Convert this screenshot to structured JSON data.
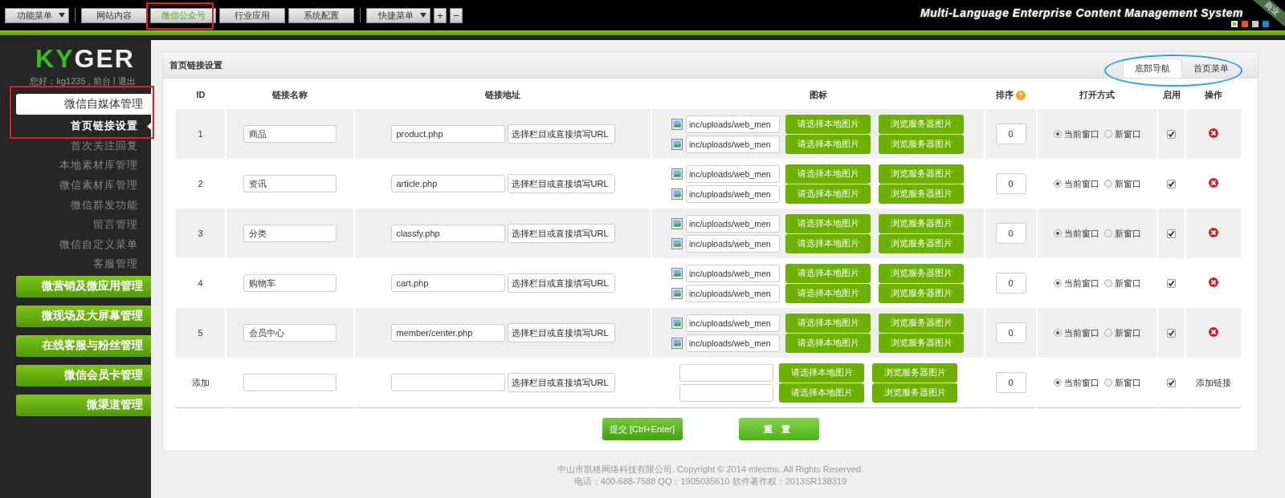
{
  "top_menu": {
    "items": [
      {
        "label": "功能菜单",
        "kind": "dropdown",
        "selected": false
      },
      {
        "label": "网站内容",
        "kind": "tab",
        "selected": false
      },
      {
        "label": "微信公众号",
        "kind": "tab",
        "selected": true
      },
      {
        "label": "行业应用",
        "kind": "tab",
        "selected": false
      },
      {
        "label": "系统配置",
        "kind": "tab",
        "selected": false
      },
      {
        "label": "快捷菜单",
        "kind": "dropdown",
        "selected": false
      },
      {
        "label": "+",
        "kind": "square",
        "selected": false
      },
      {
        "label": "−",
        "kind": "square",
        "selected": false
      }
    ]
  },
  "header": {
    "tagline": "Multi-Language Enterprise Content Management System",
    "ribbon": "商业",
    "theme_swatches": [
      {
        "color": "#8dc21f",
        "selected": true
      },
      {
        "color": "#e8531c",
        "selected": false
      },
      {
        "color": "#c8ccd0",
        "selected": false
      },
      {
        "color": "#1e88c8",
        "selected": false
      }
    ]
  },
  "sidebar": {
    "logo": "KYGER",
    "greeting": "您好：kg1235 ,",
    "links": [
      "前台",
      "退出"
    ],
    "separator": "|",
    "groups": [
      {
        "label": "微信自媒体管理",
        "expanded": true,
        "children": [
          {
            "label": "首页链接设置",
            "selected": true
          },
          {
            "label": "首次关注回复",
            "selected": false
          },
          {
            "label": "本地素材库管理",
            "selected": false
          },
          {
            "label": "微信素材库管理",
            "selected": false
          },
          {
            "label": "微信群发功能",
            "selected": false
          },
          {
            "label": "留言管理",
            "selected": false
          },
          {
            "label": "微信自定义菜单",
            "selected": false
          },
          {
            "label": "客服管理",
            "selected": false
          }
        ]
      },
      {
        "label": "微营销及微应用管理",
        "expanded": false
      },
      {
        "label": "微现场及大屏幕管理",
        "expanded": false
      },
      {
        "label": "在线客服与粉丝管理",
        "expanded": false
      },
      {
        "label": "微信会员卡管理",
        "expanded": false
      },
      {
        "label": "微渠道管理",
        "expanded": false
      }
    ]
  },
  "panel": {
    "title": "首页链接设置",
    "tabs": [
      {
        "label": "底部导航",
        "selected": true
      },
      {
        "label": "首页菜单",
        "selected": false
      }
    ],
    "table": {
      "columns": [
        "ID",
        "链接名称",
        "链接地址",
        "图标",
        "排序",
        "打开方式",
        "启用",
        "操作"
      ],
      "rows": [
        {
          "kind": "link",
          "id": "1",
          "name": "商品",
          "url": "product.php",
          "url_select": "选择栏目或直接填写URL",
          "icons": [
            {
              "path": "inc/uploads/web_men",
              "local_button": "请选择本地图片",
              "browse_button": "浏览服务器图片"
            },
            {
              "path": "inc/uploads/web_men",
              "local_button": "请选择本地图片",
              "browse_button": "浏览服务器图片"
            }
          ],
          "sort": "0",
          "open_options": [
            {
              "label": "当前窗口",
              "selected": true
            },
            {
              "label": "新窗口",
              "selected": false
            }
          ],
          "enabled": true
        },
        {
          "kind": "link",
          "id": "2",
          "name": "资讯",
          "url": "article.php",
          "url_select": "选择栏目或直接填写URL",
          "icons": [
            {
              "path": "inc/uploads/web_men",
              "local_button": "请选择本地图片",
              "browse_button": "浏览服务器图片"
            },
            {
              "path": "inc/uploads/web_men",
              "local_button": "请选择本地图片",
              "browse_button": "浏览服务器图片"
            }
          ],
          "sort": "0",
          "open_options": [
            {
              "label": "当前窗口",
              "selected": true
            },
            {
              "label": "新窗口",
              "selected": false
            }
          ],
          "enabled": true
        },
        {
          "kind": "link",
          "id": "3",
          "name": "分类",
          "url": "classfy.php",
          "url_select": "选择栏目或直接填写URL",
          "icons": [
            {
              "path": "inc/uploads/web_men",
              "local_button": "请选择本地图片",
              "browse_button": "浏览服务器图片"
            },
            {
              "path": "inc/uploads/web_men",
              "local_button": "请选择本地图片",
              "browse_button": "浏览服务器图片"
            }
          ],
          "sort": "0",
          "open_options": [
            {
              "label": "当前窗口",
              "selected": true
            },
            {
              "label": "新窗口",
              "selected": false
            }
          ],
          "enabled": true
        },
        {
          "kind": "link",
          "id": "4",
          "name": "购物车",
          "url": "cart.php",
          "url_select": "选择栏目或直接填写URL",
          "icons": [
            {
              "path": "inc/uploads/web_men",
              "local_button": "请选择本地图片",
              "browse_button": "浏览服务器图片"
            },
            {
              "path": "inc/uploads/web_men",
              "local_button": "请选择本地图片",
              "browse_button": "浏览服务器图片"
            }
          ],
          "sort": "0",
          "open_options": [
            {
              "label": "当前窗口",
              "selected": true
            },
            {
              "label": "新窗口",
              "selected": false
            }
          ],
          "enabled": true
        },
        {
          "kind": "link",
          "id": "5",
          "name": "会员中心",
          "url": "member/center.php",
          "url_select": "选择栏目或直接填写URL",
          "icons": [
            {
              "path": "inc/uploads/web_men",
              "local_button": "请选择本地图片",
              "browse_button": "浏览服务器图片"
            },
            {
              "path": "inc/uploads/web_men",
              "local_button": "请选择本地图片",
              "browse_button": "浏览服务器图片"
            }
          ],
          "sort": "0",
          "open_options": [
            {
              "label": "当前窗口",
              "selected": true
            },
            {
              "label": "新窗口",
              "selected": false
            }
          ],
          "enabled": true
        },
        {
          "kind": "new",
          "id": "添加",
          "url_select": "选择栏目或直接填写URL",
          "icons": [
            {
              "local_button": "请选择本地图片",
              "browse_button": "浏览服务器图片"
            },
            {
              "local_button": "请选择本地图片",
              "browse_button": "浏览服务器图片"
            }
          ],
          "sort": "0",
          "open_options": [
            {
              "label": "当前窗口",
              "selected": true
            },
            {
              "label": "新窗口",
              "selected": false
            }
          ],
          "enabled": true,
          "action_label": "添加链接"
        }
      ]
    },
    "buttons": [
      {
        "label": "提交 [Ctrl+Enter]",
        "kind": "submit"
      },
      {
        "label": "重 置",
        "kind": "reset"
      }
    ]
  },
  "footer": [
    "中山市凯格网络科技有限公司. Copyright © 2014 mlecms. All Rights Reserved.",
    "电话：400-688-7588  QQ：1905035610  软件著作权：2013SR138319"
  ]
}
